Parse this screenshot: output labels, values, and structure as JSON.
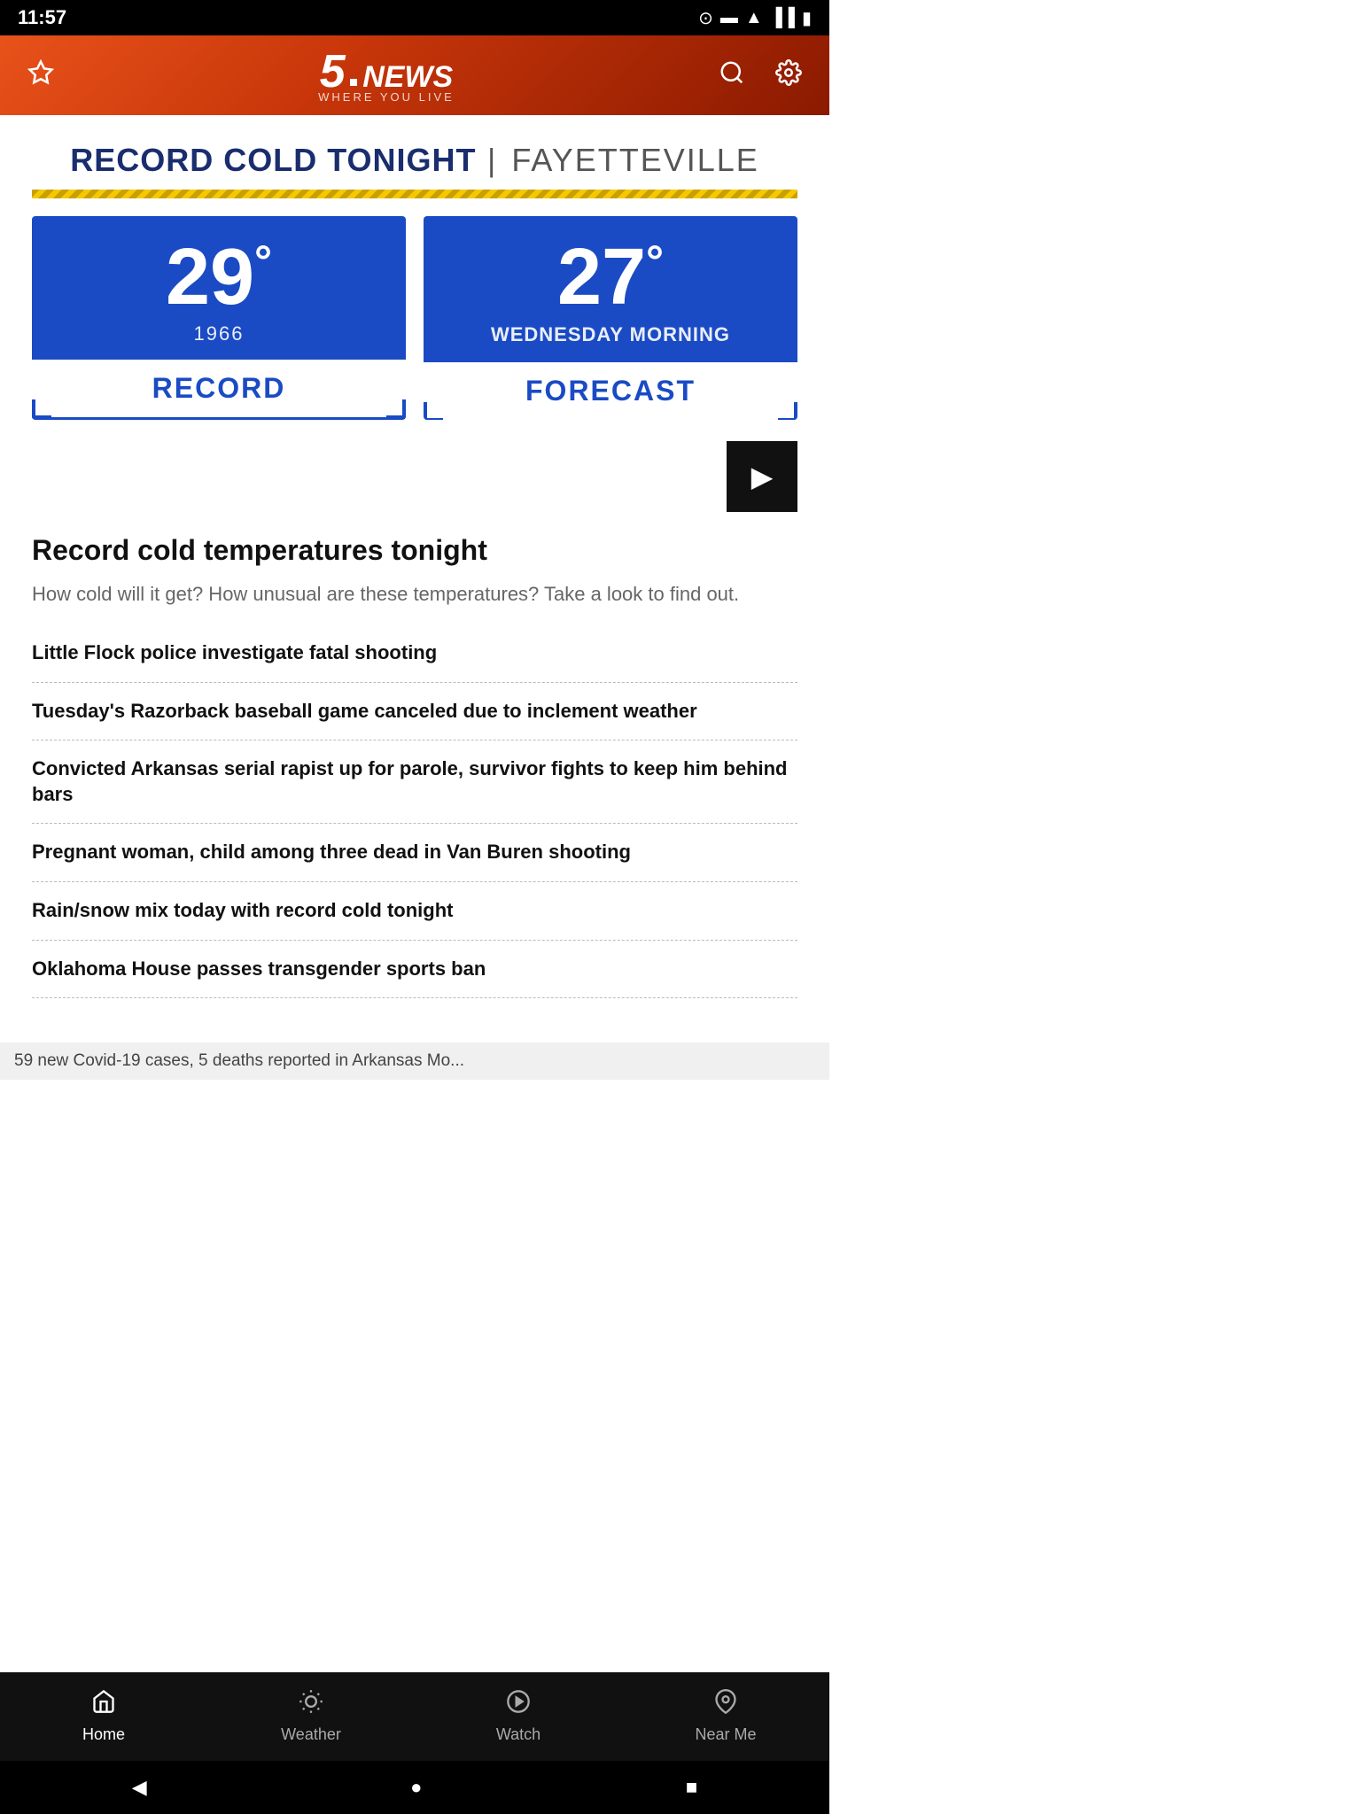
{
  "statusBar": {
    "time": "11:57",
    "icons": [
      "●",
      "▬",
      "▲",
      "▐▐",
      "▮"
    ]
  },
  "header": {
    "logoNum": "5",
    "logoText": "NEWS",
    "logoTagline": "WHERE YOU LIVE",
    "favoriteLabel": "☆",
    "searchLabel": "🔍",
    "settingsLabel": "⚙"
  },
  "weather": {
    "headline": "RECORD COLD TONIGHT",
    "divider": "|",
    "location": "FAYETTEVILLE",
    "recordCard": {
      "temp": "29",
      "degree": "°",
      "year": "1966",
      "label": "RECORD"
    },
    "forecastCard": {
      "temp": "27",
      "degree": "°",
      "subtext": "WEDNESDAY MORNING",
      "label": "FORECAST"
    }
  },
  "featuredArticle": {
    "title": "Record cold temperatures tonight",
    "description": "How cold will it get? How unusual are these temperatures? Take a look to find out."
  },
  "newsList": [
    {
      "id": 1,
      "title": "Little Flock police investigate fatal shooting"
    },
    {
      "id": 2,
      "title": "Tuesday's Razorback baseball game canceled due to inclement weather"
    },
    {
      "id": 3,
      "title": "Convicted Arkansas serial rapist up for parole, survivor fights to keep him behind bars"
    },
    {
      "id": 4,
      "title": "Pregnant woman, child among three dead in Van Buren shooting"
    },
    {
      "id": 5,
      "title": "Rain/snow mix today with record cold tonight"
    },
    {
      "id": 6,
      "title": "Oklahoma House passes transgender sports ban"
    }
  ],
  "ticker": {
    "text": "59 new Covid-19 cases, 5 deaths reported in Arkansas Mo..."
  },
  "bottomNav": {
    "items": [
      {
        "id": "home",
        "icon": "⌂",
        "label": "Home",
        "active": true
      },
      {
        "id": "weather",
        "icon": "☀",
        "label": "Weather",
        "active": false
      },
      {
        "id": "watch",
        "icon": "▶",
        "label": "Watch",
        "active": false
      },
      {
        "id": "nearme",
        "icon": "◎",
        "label": "Near Me",
        "active": false
      }
    ]
  },
  "androidNav": {
    "back": "◀",
    "home": "●",
    "recent": "■"
  }
}
